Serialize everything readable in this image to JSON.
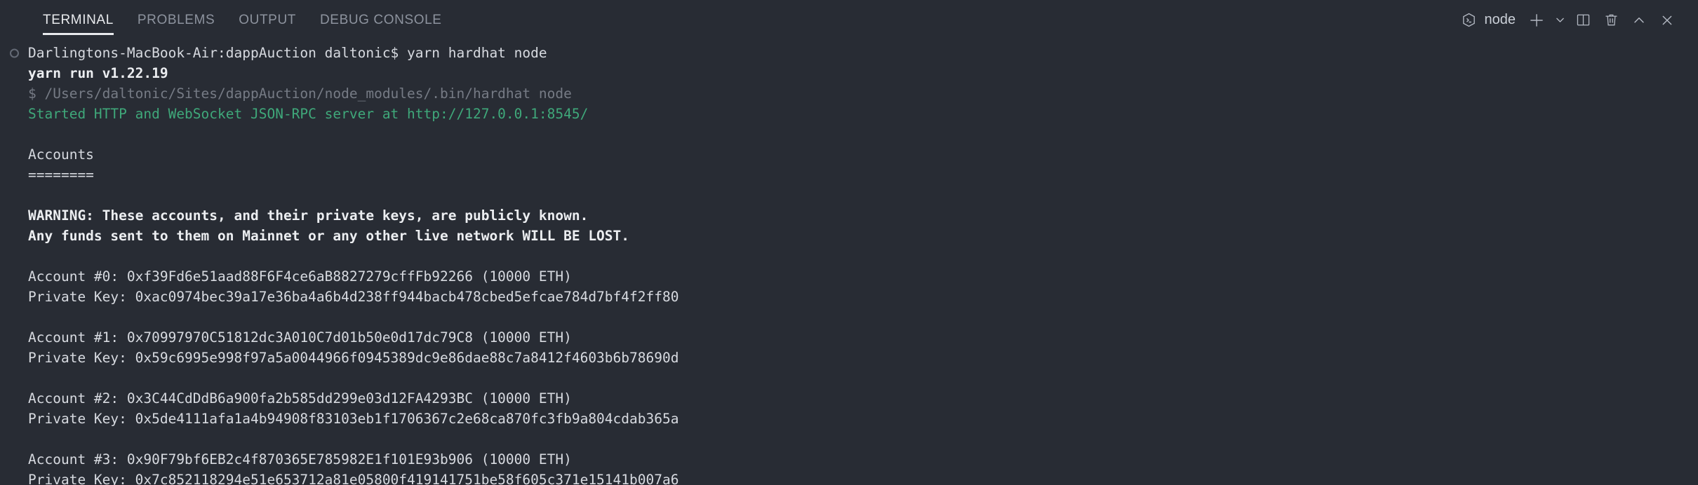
{
  "panel": {
    "tabs": [
      {
        "label": "TERMINAL",
        "active": true
      },
      {
        "label": "PROBLEMS",
        "active": false
      },
      {
        "label": "OUTPUT",
        "active": false
      },
      {
        "label": "DEBUG CONSOLE",
        "active": false
      }
    ],
    "active_terminal": {
      "name": "node",
      "icon": "terminal-cube-icon"
    },
    "actions": [
      {
        "name": "new-terminal-button",
        "icon": "plus-icon",
        "tooltip": "New Terminal"
      },
      {
        "name": "terminal-profile-dropdown",
        "icon": "chevron-down-icon",
        "tooltip": "Launch Profile"
      },
      {
        "name": "split-terminal-button",
        "icon": "split-panel-icon",
        "tooltip": "Split Terminal"
      },
      {
        "name": "kill-terminal-button",
        "icon": "trash-icon",
        "tooltip": "Kill Terminal"
      },
      {
        "name": "maximize-panel-button",
        "icon": "chevron-up-icon",
        "tooltip": "Maximize Panel"
      },
      {
        "name": "close-panel-button",
        "icon": "close-x-icon",
        "tooltip": "Close Panel"
      }
    ]
  },
  "colors": {
    "background": "#282c34",
    "foreground": "#d7dae0",
    "dim": "#767b85",
    "green": "#3fa87a",
    "bold_white": "#eceef1",
    "tab_inactive": "#8d939e",
    "tab_active": "#e8eaed"
  },
  "terminal_output": {
    "lines": [
      {
        "text": "Darlingtons-MacBook-Air:dappAuction daltonic$ yarn hardhat node",
        "style": "normal",
        "marker": true
      },
      {
        "text": "yarn run v1.22.19",
        "style": "bold",
        "marker": false
      },
      {
        "text": "$ /Users/daltonic/Sites/dappAuction/node_modules/.bin/hardhat node",
        "style": "dim",
        "marker": false
      },
      {
        "text": "Started HTTP and WebSocket JSON-RPC server at http://127.0.0.1:8545/",
        "style": "green",
        "marker": false
      },
      {
        "text": "",
        "style": "blank",
        "marker": false
      },
      {
        "text": "Accounts",
        "style": "normal",
        "marker": false
      },
      {
        "text": "========",
        "style": "normal",
        "marker": false
      },
      {
        "text": "",
        "style": "blank",
        "marker": false
      },
      {
        "text": "WARNING: These accounts, and their private keys, are publicly known.",
        "style": "bold",
        "marker": false
      },
      {
        "text": "Any funds sent to them on Mainnet or any other live network WILL BE LOST.",
        "style": "bold",
        "marker": false
      },
      {
        "text": "",
        "style": "blank",
        "marker": false
      },
      {
        "text": "Account #0: 0xf39Fd6e51aad88F6F4ce6aB8827279cffFb92266 (10000 ETH)",
        "style": "normal",
        "marker": false
      },
      {
        "text": "Private Key: 0xac0974bec39a17e36ba4a6b4d238ff944bacb478cbed5efcae784d7bf4f2ff80",
        "style": "normal",
        "marker": false
      },
      {
        "text": "",
        "style": "blank",
        "marker": false
      },
      {
        "text": "Account #1: 0x70997970C51812dc3A010C7d01b50e0d17dc79C8 (10000 ETH)",
        "style": "normal",
        "marker": false
      },
      {
        "text": "Private Key: 0x59c6995e998f97a5a0044966f0945389dc9e86dae88c7a8412f4603b6b78690d",
        "style": "normal",
        "marker": false
      },
      {
        "text": "",
        "style": "blank",
        "marker": false
      },
      {
        "text": "Account #2: 0x3C44CdDdB6a900fa2b585dd299e03d12FA4293BC (10000 ETH)",
        "style": "normal",
        "marker": false
      },
      {
        "text": "Private Key: 0x5de4111afa1a4b94908f83103eb1f1706367c2e68ca870fc3fb9a804cdab365a",
        "style": "normal",
        "marker": false
      },
      {
        "text": "",
        "style": "blank",
        "marker": false
      },
      {
        "text": "Account #3: 0x90F79bf6EB2c4f870365E785982E1f101E93b906 (10000 ETH)",
        "style": "normal",
        "marker": false
      },
      {
        "text": "Private Key: 0x7c852118294e51e653712a81e05800f419141751be58f605c371e15141b007a6",
        "style": "normal",
        "marker": false
      }
    ]
  }
}
